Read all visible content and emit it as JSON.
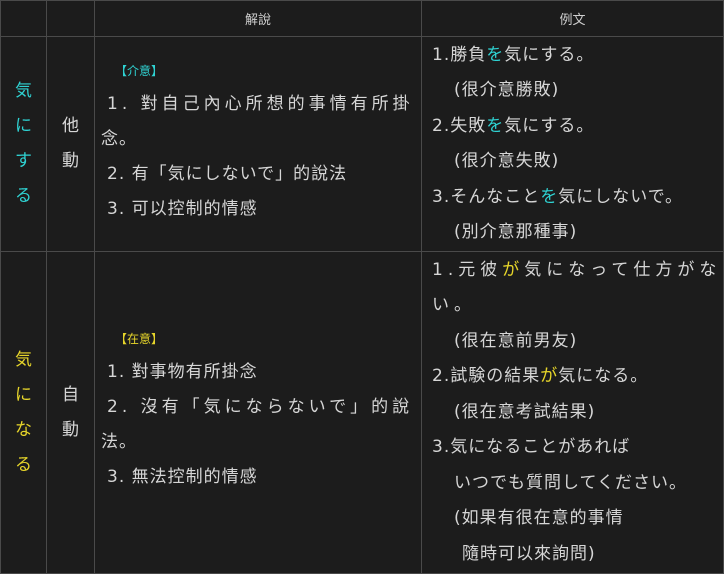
{
  "header": {
    "explain": "解說",
    "example": "例文"
  },
  "rows": [
    {
      "word": [
        "気",
        "に",
        "す",
        "る"
      ],
      "pos": [
        "他",
        "動"
      ],
      "tag": "【介意】",
      "explain": [
        "1. 對自己內心所想的事情有所掛",
        "念。",
        "2. 有「気にしないで」的說法",
        "3. 可以控制的情感"
      ],
      "examples": [
        {
          "pre": "1.勝負",
          "hl": "を",
          "post": "気にする。"
        },
        {
          "text": "(很介意勝敗)"
        },
        {
          "pre": "2.失敗",
          "hl": "を",
          "post": "気にする。"
        },
        {
          "text": "(很介意失敗)"
        },
        {
          "pre": "3.そんなこと",
          "hl": "を",
          "post": "気にしないで。"
        },
        {
          "text": "(別介意那種事)"
        }
      ]
    },
    {
      "word": [
        "気",
        "に",
        "な",
        "る"
      ],
      "pos": [
        "自",
        "動"
      ],
      "tag": "【在意】",
      "explain": [
        "1. 對事物有所掛念",
        "2. 沒有「気にならないで」的說",
        "法。",
        "3. 無法控制的情感"
      ],
      "examples": [
        {
          "pre": "1.元彼",
          "hl": "が",
          "post": "気になって仕方がな"
        },
        {
          "text": "い。"
        },
        {
          "text": "(很在意前男友)"
        },
        {
          "pre": "2.試験の結果",
          "hl": "が",
          "post": "気になる。"
        },
        {
          "text": "(很在意考試結果)"
        },
        {
          "text": "3.気になることがあれば"
        },
        {
          "text": "いつでも質問してください。"
        },
        {
          "text": "(如果有很在意的事情"
        },
        {
          "text": "隨時可以來詢問)"
        }
      ]
    }
  ],
  "colors": {
    "cyan": "#2fd2d2",
    "yellow": "#e6d52a"
  }
}
